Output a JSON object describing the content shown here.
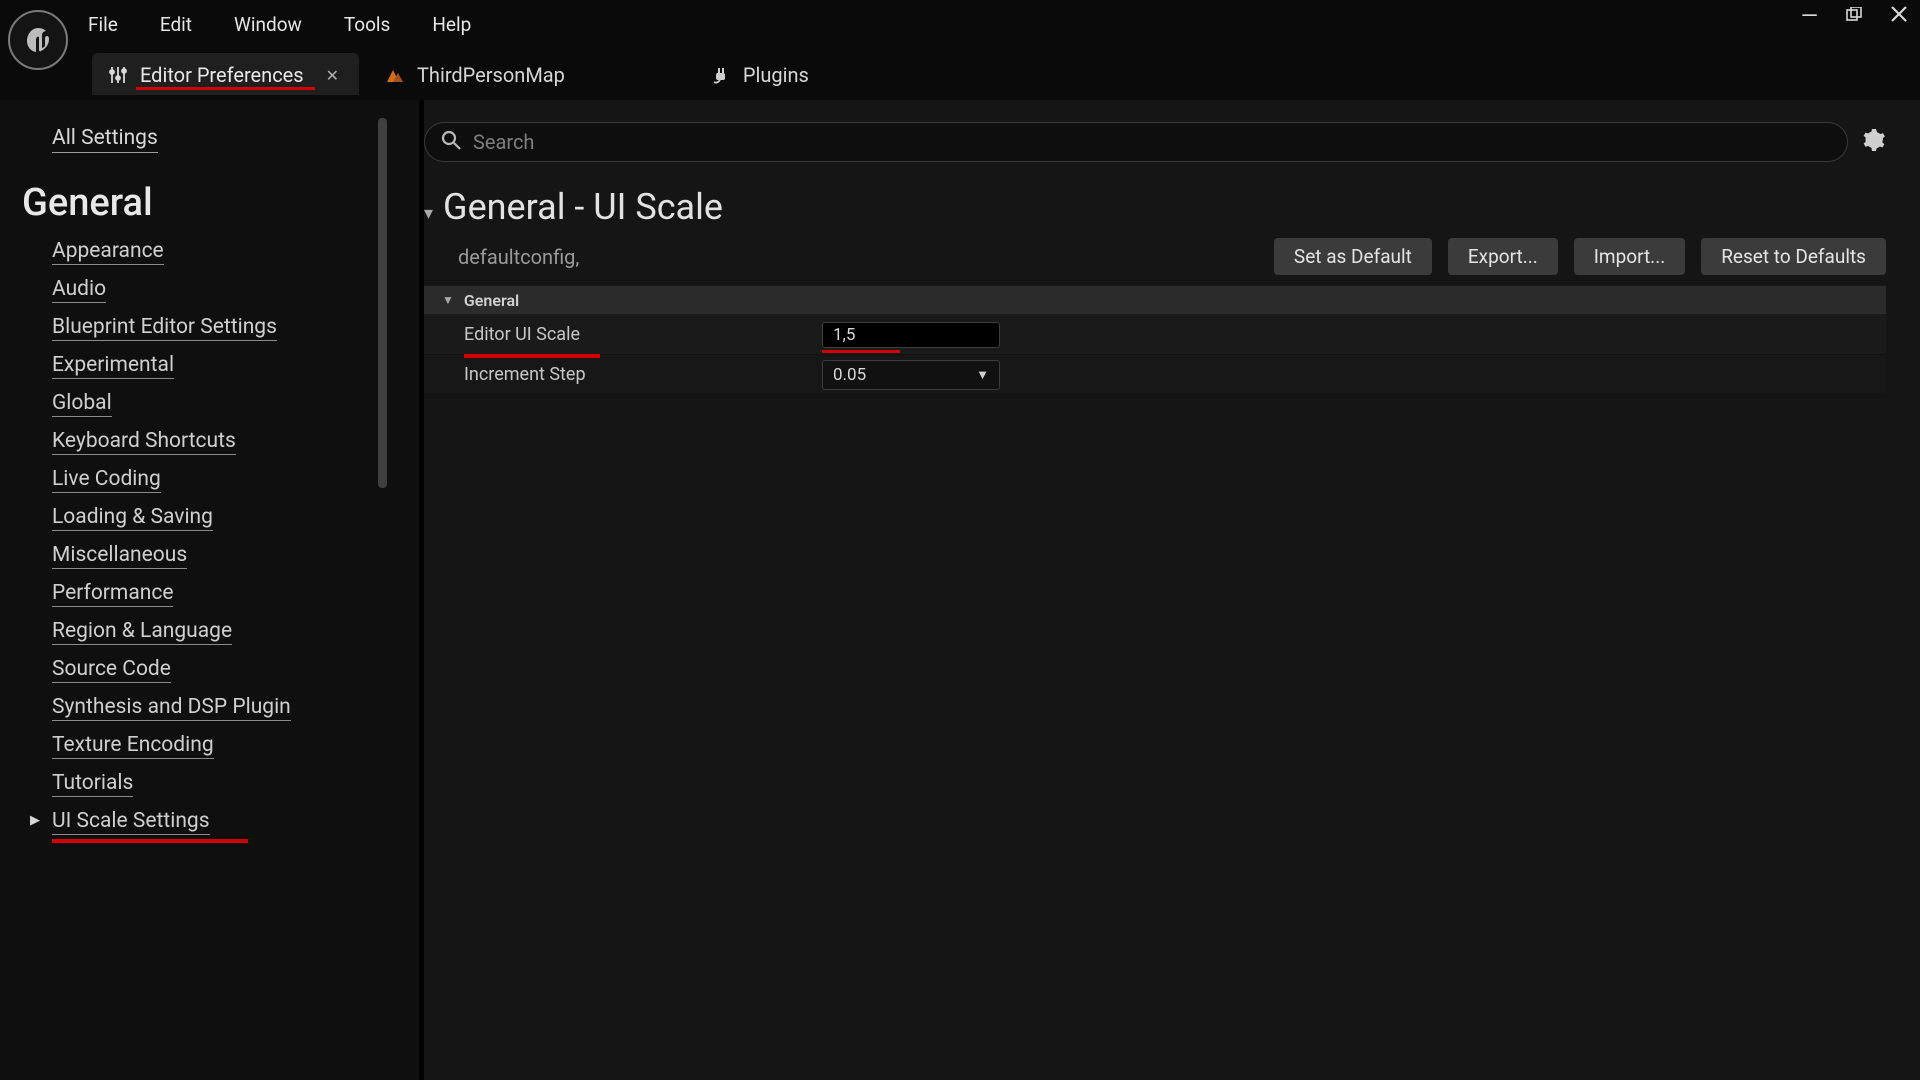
{
  "menu": {
    "items": [
      "File",
      "Edit",
      "Window",
      "Tools",
      "Help"
    ]
  },
  "tabs": [
    {
      "label": "Editor Preferences",
      "active": true,
      "closable": true
    },
    {
      "label": "ThirdPersonMap"
    },
    {
      "label": "Plugins"
    }
  ],
  "sidebar": {
    "all_settings": "All Settings",
    "heading": "General",
    "categories": [
      "Appearance",
      "Audio",
      "Blueprint Editor Settings",
      "Experimental",
      "Global",
      "Keyboard Shortcuts",
      "Live Coding",
      "Loading & Saving",
      "Miscellaneous",
      "Performance",
      "Region & Language",
      "Source Code",
      "Synthesis and DSP Plugin",
      "Texture Encoding",
      "Tutorials",
      "UI Scale Settings"
    ],
    "selected_index": 15
  },
  "search": {
    "placeholder": "Search"
  },
  "detail": {
    "title": "General - UI Scale",
    "config_note": "defaultconfig,",
    "buttons": {
      "set_default": "Set as Default",
      "export": "Export...",
      "import": "Import...",
      "reset": "Reset to Defaults"
    },
    "group_label": "General",
    "props": {
      "ui_scale": {
        "label": "Editor UI Scale",
        "value": "1,5"
      },
      "increment": {
        "label": "Increment Step",
        "value": "0.05"
      }
    }
  }
}
